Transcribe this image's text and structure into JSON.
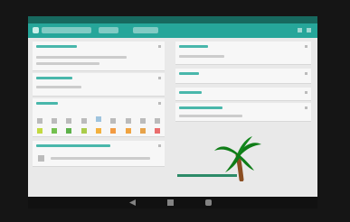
{
  "statusbar": {
    "left": "",
    "right": ""
  },
  "appbar": {
    "title": "",
    "tab1": "",
    "tab2": ""
  },
  "colors": {
    "appbar": "#26a69a",
    "status": "#17695f",
    "surface": "#e9e9e9",
    "card": "#f7f7f7"
  },
  "left_cards": [
    {
      "title": ""
    },
    {
      "title": ""
    },
    {
      "title": ""
    },
    {
      "title": ""
    }
  ],
  "right_cards": [
    {
      "title": ""
    },
    {
      "title": ""
    },
    {
      "title": ""
    },
    {
      "title": ""
    }
  ],
  "icons": {
    "app": "app-icon",
    "search": "search-icon",
    "more": "more-icon",
    "back": "back-icon",
    "home": "home-icon",
    "recent": "recent-icon",
    "palm": "palm-tree-icon"
  }
}
